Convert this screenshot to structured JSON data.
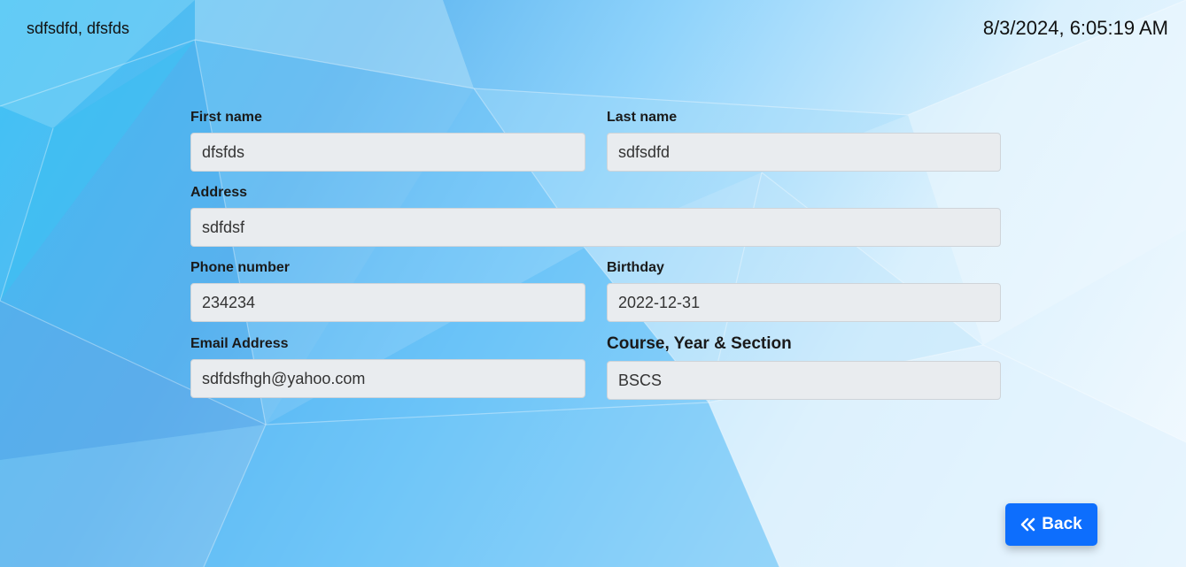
{
  "header": {
    "user_name": "sdfsdfd, dfsfds",
    "datetime": "8/3/2024, 6:05:19 AM"
  },
  "form": {
    "first_name": {
      "label": "First name",
      "value": "dfsfds"
    },
    "last_name": {
      "label": "Last name",
      "value": "sdfsdfd"
    },
    "address": {
      "label": "Address",
      "value": "sdfdsf"
    },
    "phone": {
      "label": "Phone number",
      "value": "234234"
    },
    "birthday": {
      "label": "Birthday",
      "value": "2022-12-31"
    },
    "email": {
      "label": "Email Address",
      "value": "sdfdsfhgh@yahoo.com"
    },
    "course": {
      "label": "Course, Year & Section",
      "value": "BSCS"
    }
  },
  "actions": {
    "back_label": "Back",
    "back_icon": "double-chevron-left-icon",
    "back_color": "#0d6efd"
  }
}
